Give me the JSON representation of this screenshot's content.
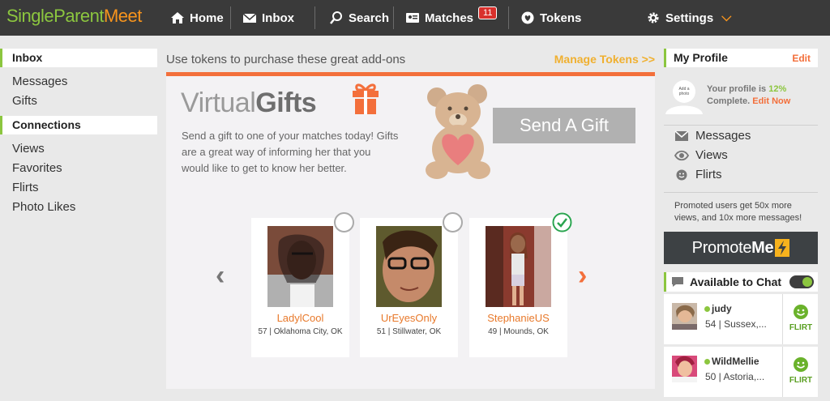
{
  "header": {
    "logo_part1": "SingleParent",
    "logo_part2": "Meet",
    "nav": {
      "home": "Home",
      "inbox": "Inbox",
      "search": "Search",
      "matches": "Matches",
      "matches_badge": "11",
      "tokens": "Tokens",
      "settings": "Settings"
    }
  },
  "left_sidebar": {
    "inbox_title": "Inbox",
    "inbox_items": [
      "Messages",
      "Gifts"
    ],
    "connections_title": "Connections",
    "connections_items": [
      "Views",
      "Favorites",
      "Flirts",
      "Photo Likes"
    ]
  },
  "main": {
    "heading": "Use tokens to purchase these great add-ons",
    "manage_tokens": "Manage Tokens >>",
    "virtual_gifts": {
      "title_light": "Virtual",
      "title_bold": "Gifts",
      "description": "Send a gift to one of your matches today! Gifts are a great way of informing her that you would like to get to know her better.",
      "send_button": "Send A Gift"
    },
    "matches": [
      {
        "name": "LadylCool",
        "info": "57 | Oklahoma City, OK",
        "selected": false
      },
      {
        "name": "UrEyesOnly",
        "info": "51 | Stillwater, OK",
        "selected": false
      },
      {
        "name": "StephanieUS",
        "info": "49 | Mounds, OK",
        "selected": true
      }
    ]
  },
  "right_sidebar": {
    "my_profile_title": "My Profile",
    "edit_label": "Edit",
    "avatar_placeholder": "Add a photo",
    "profile_text_1": "Your profile is",
    "profile_pct": "12%",
    "profile_text_2": "Complete.",
    "edit_now": "Edit Now",
    "links": [
      "Messages",
      "Views",
      "Flirts"
    ],
    "promo_text": "Promoted users get 50x more views, and 10x more messages!",
    "promote_light": "Promote",
    "promote_bold": "Me",
    "chat_title": "Available to Chat",
    "chat_users": [
      {
        "name": "judy",
        "info": "54 | Sussex,...",
        "flirt": "FLIRT"
      },
      {
        "name": "WildMellie",
        "info": "50 | Astoria,...",
        "flirt": "FLIRT"
      }
    ]
  },
  "colors": {
    "accent_green": "#8cc63f",
    "accent_orange": "#f36f3b",
    "topbar": "#3a3a3a"
  }
}
